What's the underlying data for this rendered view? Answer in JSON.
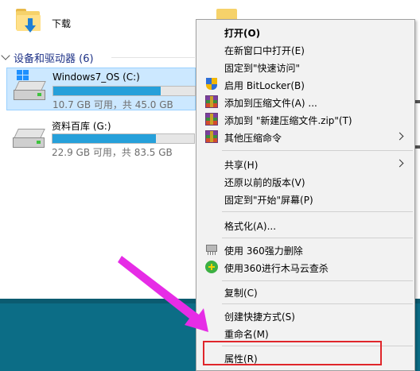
{
  "explorer": {
    "folder_label": "下载",
    "section_title": "设备和驱动器 (6)",
    "drives": [
      {
        "name": "Windows7_OS (C:)",
        "space": "10.7 GB 可用，共 45.0 GB",
        "used_fraction": 0.76,
        "selected": true
      },
      {
        "name": "资料百库 (G:)",
        "space": "22.9 GB 可用，共 83.5 GB",
        "used_fraction": 0.73,
        "selected": false
      }
    ]
  },
  "context_menu": {
    "items": [
      {
        "label": "打开(O)",
        "bold": true
      },
      {
        "label": "在新窗口中打开(E)"
      },
      {
        "label": "固定到\"快速访问\""
      },
      {
        "label": "启用 BitLocker(B)",
        "icon": "bitlocker-shield-icon"
      },
      {
        "label": "添加到压缩文件(A) ...",
        "icon": "winrar-icon"
      },
      {
        "label": "添加到 \"新建压缩文件.zip\"(T)",
        "icon": "winrar-icon"
      },
      {
        "label": "其他压缩命令",
        "icon": "winrar-icon",
        "submenu": true
      },
      {
        "label": "共享(H)",
        "submenu": true
      },
      {
        "label": "还原以前的版本(V)"
      },
      {
        "label": "固定到\"开始\"屏幕(P)"
      },
      {
        "label": "格式化(A)..."
      },
      {
        "label": "使用 360强力删除",
        "icon": "shredder-icon"
      },
      {
        "label": "使用360进行木马云查杀",
        "icon": "360-antivirus-icon"
      },
      {
        "label": "复制(C)"
      },
      {
        "label": "创建快捷方式(S)"
      },
      {
        "label": "重命名(M)"
      },
      {
        "label": "属性(R)"
      }
    ]
  },
  "annotation": {
    "arrow_color": "#e62ce6",
    "box_color": "#e0262b"
  },
  "colors": {
    "accent": "#26a0da",
    "selection": "#cce8ff",
    "menu_bg": "#f2f2f2",
    "desktop": "#0c6d86"
  }
}
